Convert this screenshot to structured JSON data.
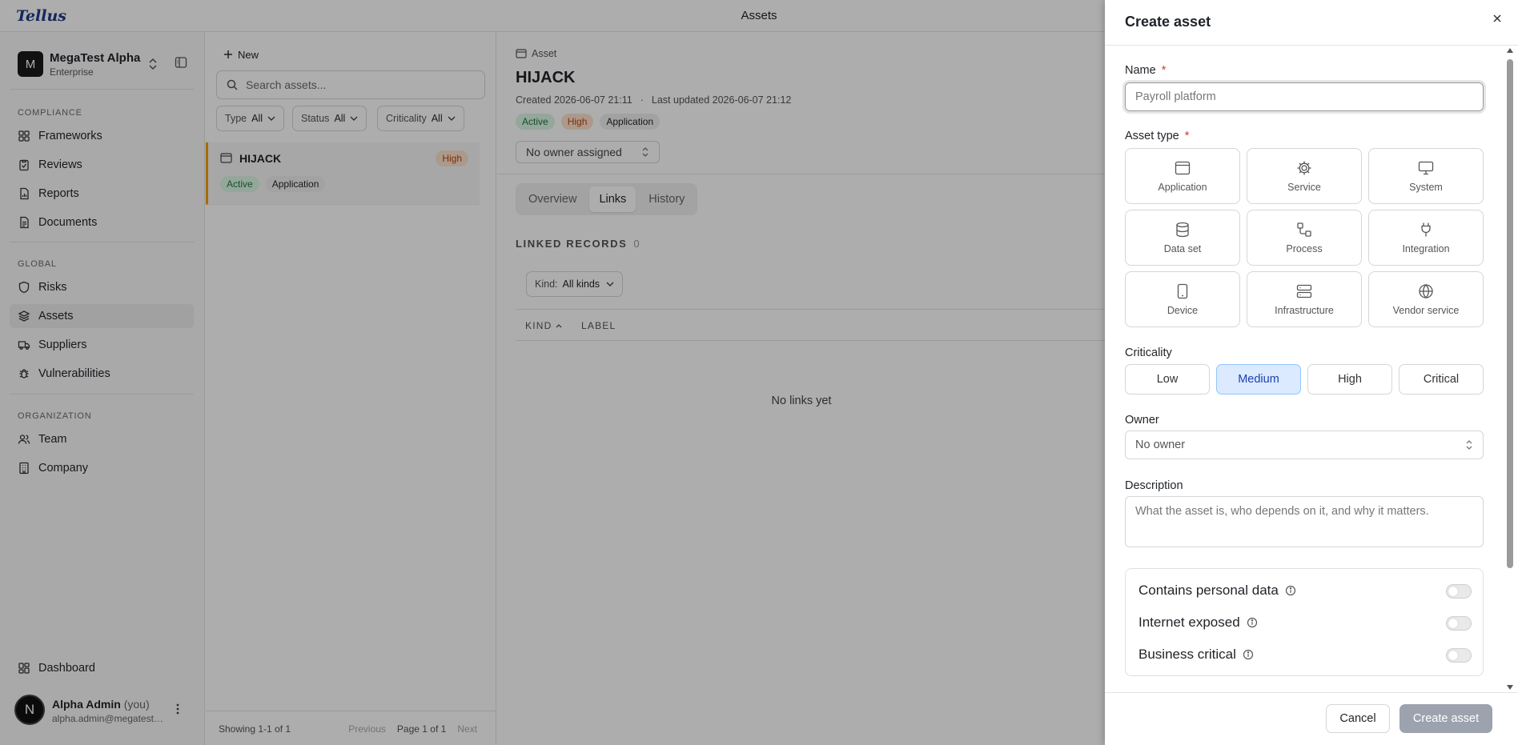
{
  "app": {
    "logo": "Tellus",
    "page_title": "Assets"
  },
  "sidebar": {
    "org_initial": "M",
    "org_name": "MegaTest Alpha",
    "org_plan": "Enterprise",
    "sections": {
      "compliance": "COMPLIANCE",
      "global": "GLOBAL",
      "organization": "ORGANIZATION"
    },
    "items": {
      "frameworks": "Frameworks",
      "reviews": "Reviews",
      "reports": "Reports",
      "documents": "Documents",
      "risks": "Risks",
      "assets": "Assets",
      "suppliers": "Suppliers",
      "vulnerabilities": "Vulnerabilities",
      "team": "Team",
      "company": "Company",
      "dashboard": "Dashboard"
    },
    "user": {
      "initial": "N",
      "name": "Alpha Admin",
      "you": "(you)",
      "email": "alpha.admin@megatest.example"
    }
  },
  "list": {
    "new_label": "New",
    "search_placeholder": "Search assets...",
    "filters": [
      {
        "label": "Type",
        "value": "All"
      },
      {
        "label": "Status",
        "value": "All"
      },
      {
        "label": "Criticality",
        "value": "All"
      }
    ],
    "rows": [
      {
        "title": "HIJACK",
        "criticality": "High",
        "status": "Active",
        "type": "Application"
      }
    ],
    "footer": {
      "count": "Showing 1-1 of 1",
      "previous": "Previous",
      "page": "Page 1 of 1",
      "next": "Next"
    }
  },
  "detail": {
    "kicker": "Asset",
    "title": "HIJACK",
    "created": "Created 2026-06-07 21:11",
    "separator": "·",
    "updated": "Last updated 2026-06-07 21:12",
    "badges": {
      "status": "Active",
      "criticality": "High",
      "type": "Application"
    },
    "owner": "No owner assigned",
    "tabs": [
      "Overview",
      "Links",
      "History"
    ],
    "active_tab": "Links",
    "linked_label": "LINKED RECORDS",
    "linked_count": "0",
    "kind_filter": {
      "label": "Kind:",
      "value": "All kinds"
    },
    "columns": {
      "kind": "KIND",
      "label": "LABEL"
    },
    "empty": "No links yet"
  },
  "drawer": {
    "title": "Create asset",
    "name_label": "Name",
    "required_mark": "*",
    "name_placeholder": "Payroll platform",
    "type_label": "Asset type",
    "types": [
      {
        "label": "Application",
        "icon": "window-icon"
      },
      {
        "label": "Service",
        "icon": "gear-icon"
      },
      {
        "label": "System",
        "icon": "monitor-icon"
      },
      {
        "label": "Data set",
        "icon": "database-icon"
      },
      {
        "label": "Process",
        "icon": "workflow-icon"
      },
      {
        "label": "Integration",
        "icon": "plug-icon"
      },
      {
        "label": "Device",
        "icon": "smartphone-icon"
      },
      {
        "label": "Infrastructure",
        "icon": "server-icon"
      },
      {
        "label": "Vendor service",
        "icon": "globe-icon"
      }
    ],
    "criticality_label": "Criticality",
    "criticality_options": [
      "Low",
      "Medium",
      "High",
      "Critical"
    ],
    "criticality_selected": "Medium",
    "owner_label": "Owner",
    "owner_value": "No owner",
    "description_label": "Description",
    "description_placeholder": "What the asset is, who depends on it, and why it matters.",
    "flags": [
      {
        "label": "Contains personal data",
        "on": false
      },
      {
        "label": "Internet exposed",
        "on": false
      },
      {
        "label": "Business critical",
        "on": false
      }
    ],
    "cancel": "Cancel",
    "create": "Create asset"
  },
  "colors": {
    "selected_chip": "#dbeafe",
    "status_active": "#1b7a3e",
    "criticality_high": "#c2410c",
    "logo": "#1e3a8a"
  }
}
